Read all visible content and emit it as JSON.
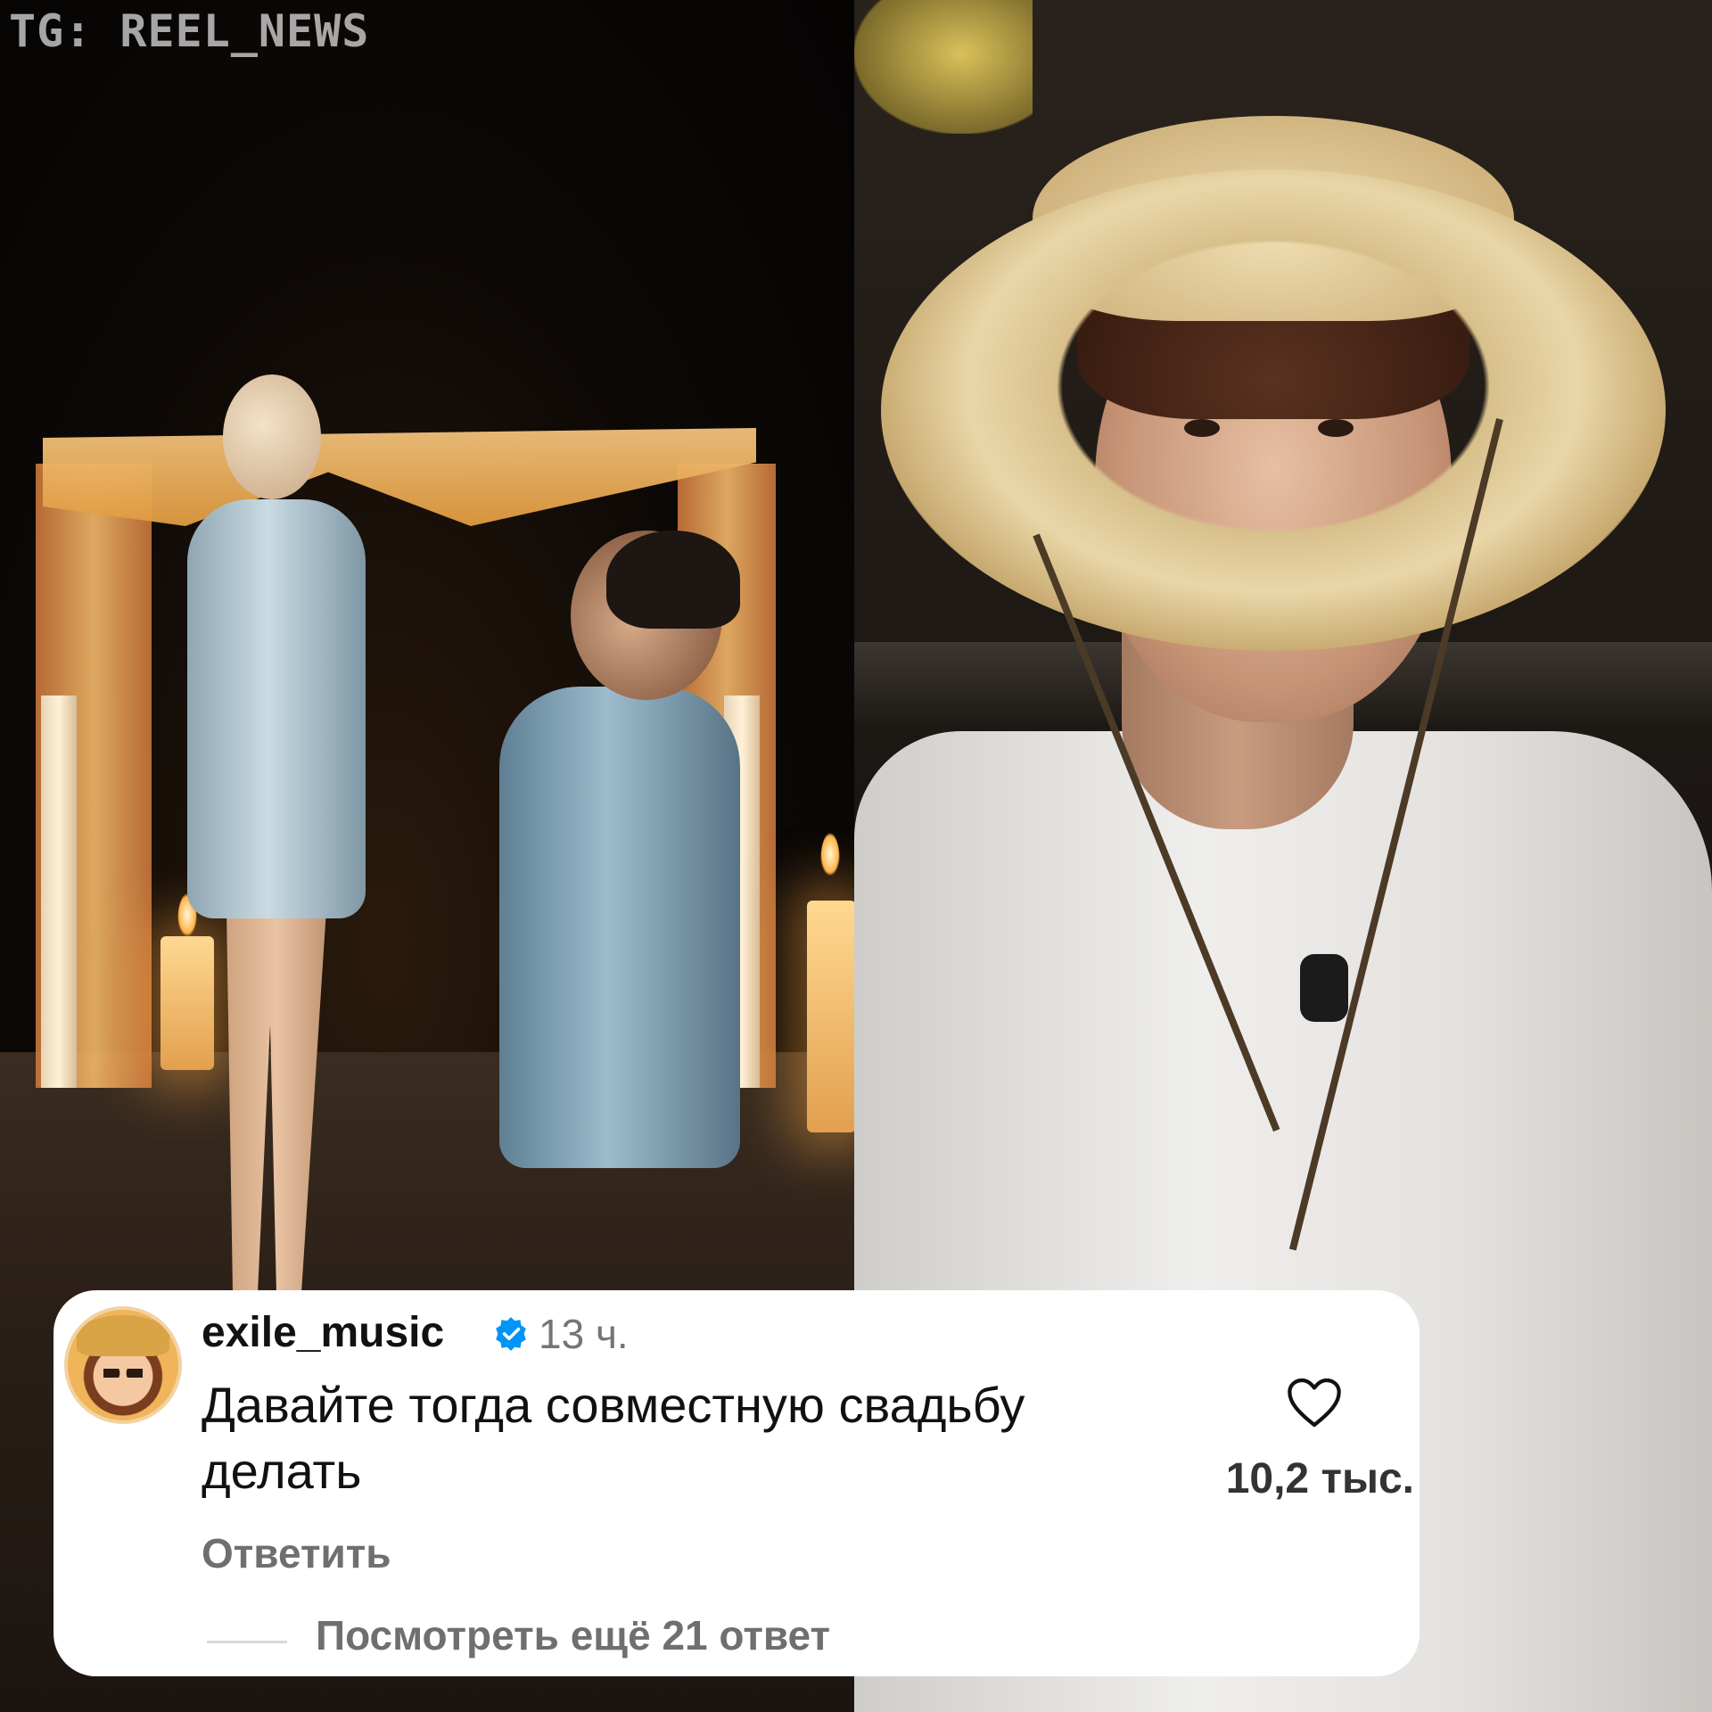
{
  "watermark": "TG: REEL_NEWS",
  "comment": {
    "username": "exile_music",
    "verified": true,
    "timestamp": "13 ч.",
    "text": "Давайте тогда совместную свадьбу делать",
    "reply_label": "Ответить",
    "like_count": "10,2 тыс.",
    "view_replies_label": "Посмотреть ещё 21 ответ"
  },
  "icons": {
    "verified": "verified-badge-icon",
    "like": "heart-outline-icon",
    "avatar": "cartoon-avatar"
  },
  "colors": {
    "verified_blue": "#0095f6",
    "card_bg": "#ffffff",
    "secondary_text": "#6f6f6f"
  }
}
